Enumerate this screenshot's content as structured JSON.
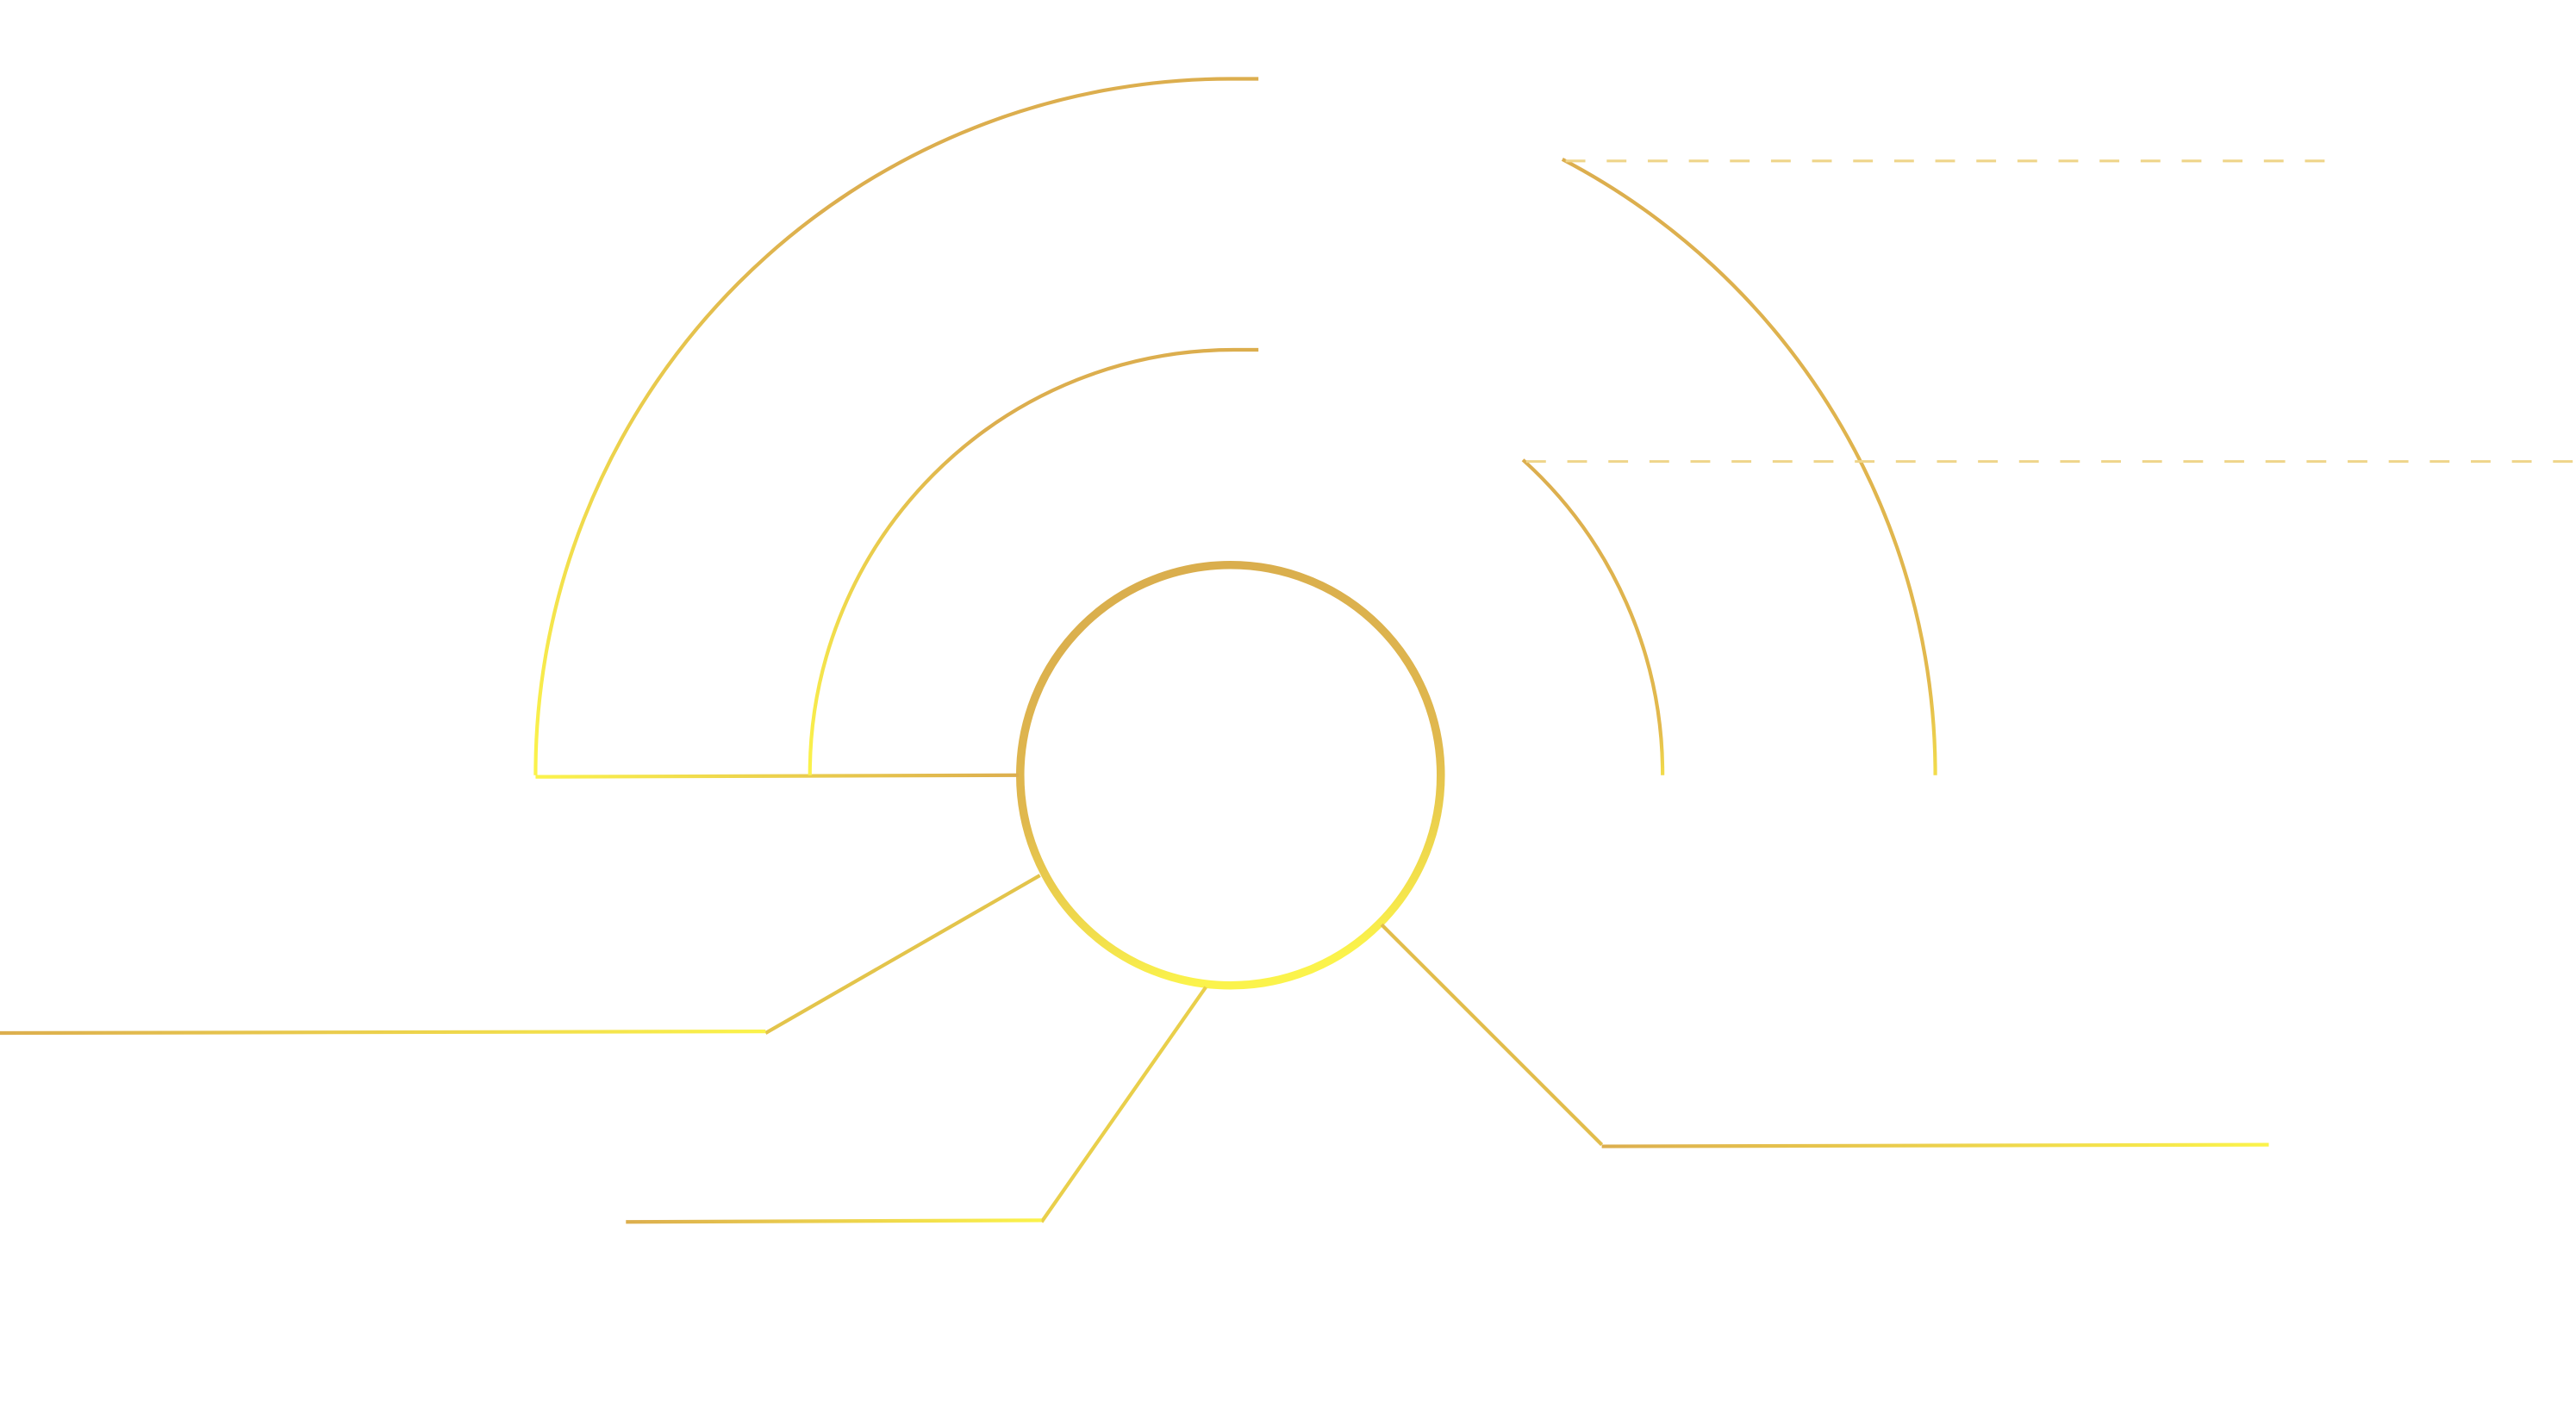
{
  "diagram": {
    "kind": "decorative-line-diagram",
    "text_labels": [],
    "colors": {
      "gold": "#dcae4e",
      "yellow": "#fbf34b",
      "dash": "#efd58a",
      "background": "#ffffff"
    },
    "elements": {
      "center_circle": "center-circle",
      "outer_arc": "outer-arc-with-bracket",
      "inner_arc": "inner-arc-with-bracket",
      "connectors": [
        "connector-left-upper",
        "connector-left-lower",
        "connector-right-lower"
      ],
      "dashed_guides": [
        "dashed-guide-upper",
        "dashed-guide-lower"
      ]
    }
  }
}
